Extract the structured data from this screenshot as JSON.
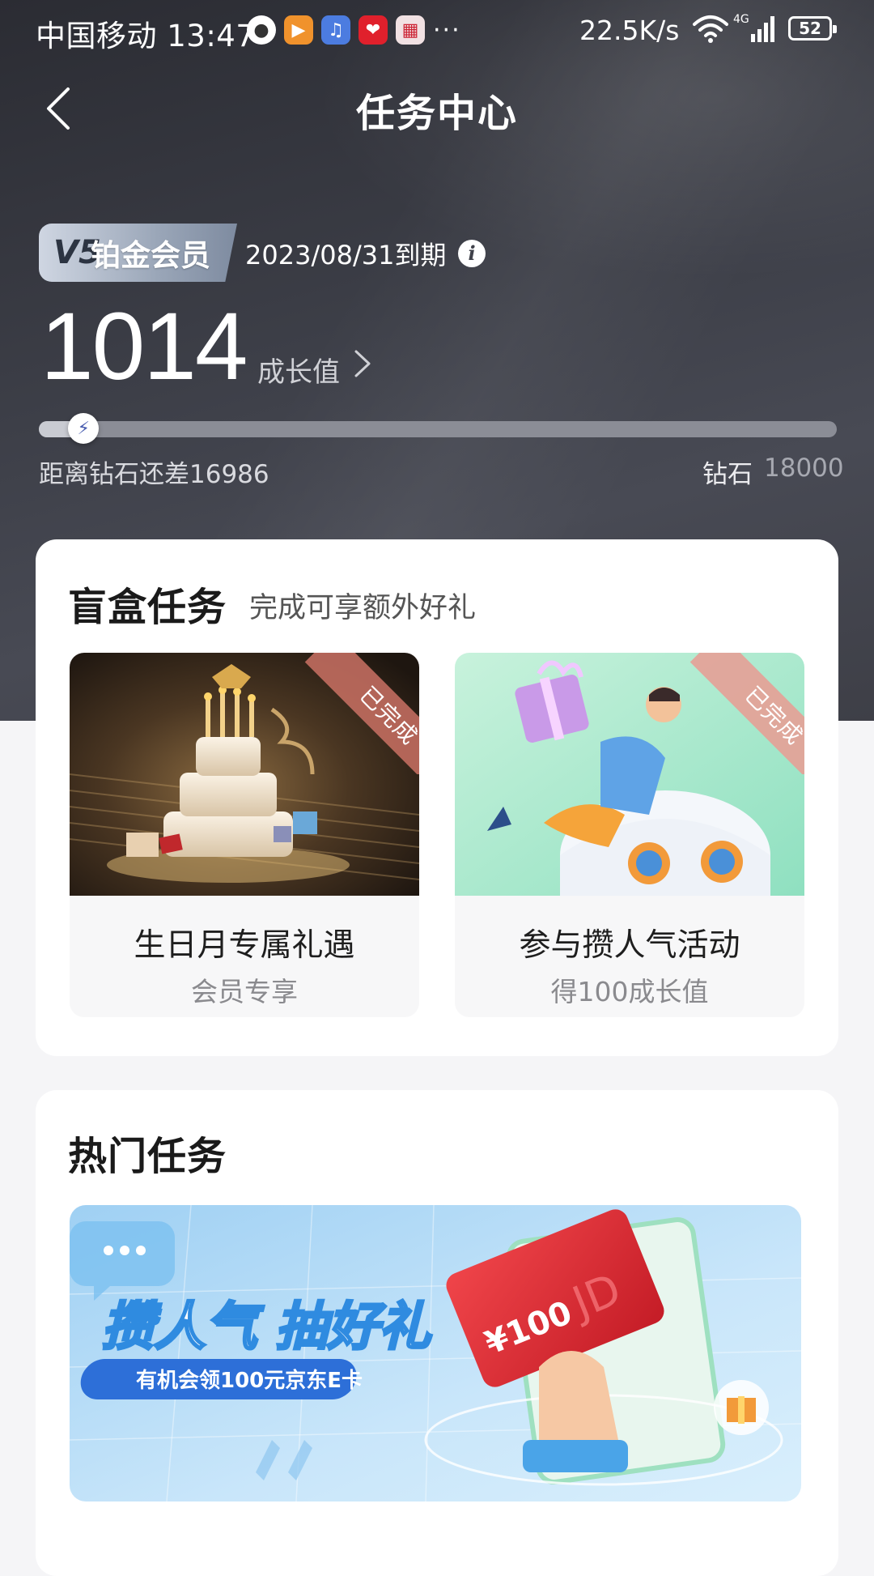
{
  "status_bar": {
    "carrier_time": "中国移动 13:47",
    "more": "···",
    "net_speed": "22.5K/s",
    "network": "4G",
    "battery": "52"
  },
  "header": {
    "title": "任务中心",
    "back_icon": "chevron-left-icon"
  },
  "member": {
    "level": "V5",
    "tier": "铂金会员",
    "expiry": "2023/08/31到期",
    "info_icon": "info-icon"
  },
  "growth": {
    "points": "1014",
    "label": "成长值",
    "remaining_text": "距离钻石还差16986",
    "target_label": "钻石",
    "target_value": "18000",
    "progress_fraction": 0.056
  },
  "blind_box": {
    "title": "盲盒任务",
    "subtitle": "完成可享额外好礼",
    "items": [
      {
        "title": "生日月专属礼遇",
        "desc": "会员专享",
        "ribbon": "已完成"
      },
      {
        "title": "参与攒人气活动",
        "desc": "得100成长值",
        "ribbon": "已完成"
      }
    ]
  },
  "hot_tasks": {
    "title": "热门任务",
    "banner": {
      "headline": "攒人气 抽好礼",
      "sub": "有机会领100元京东E卡",
      "card_amount": "¥100",
      "card_brand": "JD"
    }
  },
  "colors": {
    "hero_bg": "#3d3f48",
    "badge": "#9aa6b8",
    "ribbon": "#ca7164",
    "banner_bg": "#bfe0f7"
  }
}
